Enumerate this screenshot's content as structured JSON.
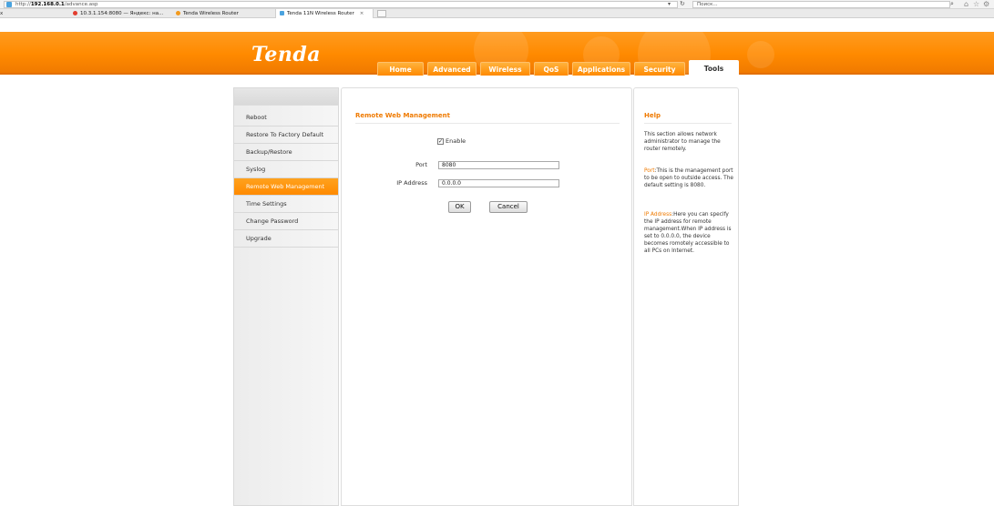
{
  "browser": {
    "url_prefix": "http://",
    "url_host": "192.168.0.1",
    "url_path": "/advance.asp",
    "search_placeholder": "Поиск...",
    "left_char": "x",
    "tabs": [
      {
        "label": "10.3.1.154:8080 — Яндекс: на..."
      },
      {
        "label": "Tenda Wireless Router"
      },
      {
        "label": "Tenda 11N Wireless Router",
        "close": "×"
      }
    ]
  },
  "header": {
    "logo": "Tenda",
    "nav": [
      "Home",
      "Advanced",
      "Wireless",
      "QoS",
      "Applications",
      "Security",
      "Tools"
    ],
    "active_nav": "Tools"
  },
  "sidebar": {
    "items": [
      {
        "label": "Reboot"
      },
      {
        "label": "Restore To Factory Default"
      },
      {
        "label": "Backup/Restore"
      },
      {
        "label": "Syslog"
      },
      {
        "label": "Remote Web Management",
        "active": true
      },
      {
        "label": "Time Settings"
      },
      {
        "label": "Change Password"
      },
      {
        "label": "Upgrade"
      }
    ]
  },
  "main": {
    "title": "Remote Web Management",
    "enable_label": "Enable",
    "enable_checked": true,
    "check_mark": "✓",
    "port_label": "Port",
    "port_value": "8080",
    "ip_label": "IP Address",
    "ip_value": "0.0.0.0",
    "ok_label": "OK",
    "cancel_label": "Cancel"
  },
  "help": {
    "title": "Help",
    "p1": "This section allows network administrator to manage the router remotely.",
    "p2_key": "Port",
    "p2_text": ":This is the management port to be open to outside access. The default setting is 8080.",
    "p3_key": "IP Address",
    "p3_text": ":Here you can specify the IP address for remote management.When IP address is set to 0.0.0.0, the device becomes romotely accessible to all PCs on Internet."
  },
  "colors": {
    "accent": "#ff8a00",
    "heading": "#ef7a00"
  }
}
